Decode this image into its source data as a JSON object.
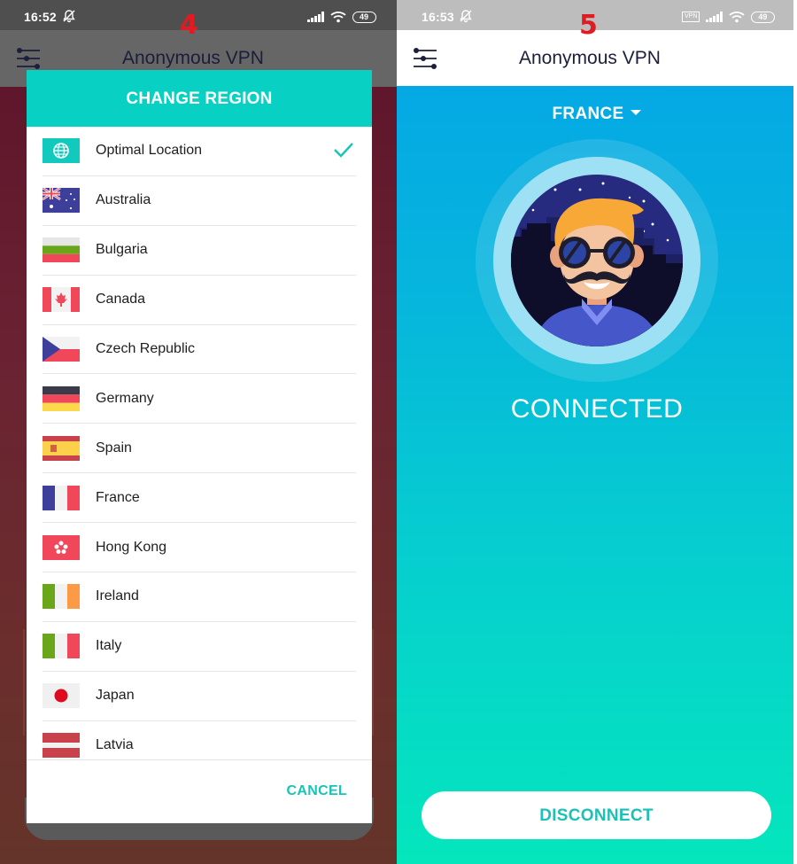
{
  "screen_left": {
    "step_number": "4",
    "status_bar": {
      "time": "16:52",
      "battery": "49"
    },
    "app_title": "Anonymous VPN",
    "dialog": {
      "title": "CHANGE REGION",
      "selected_index": 0,
      "regions": [
        {
          "label": "Optimal Location",
          "flag": "globe",
          "selected": true
        },
        {
          "label": "Australia",
          "flag": "au"
        },
        {
          "label": "Bulgaria",
          "flag": "bg"
        },
        {
          "label": "Canada",
          "flag": "ca"
        },
        {
          "label": "Czech Republic",
          "flag": "cz"
        },
        {
          "label": "Germany",
          "flag": "de"
        },
        {
          "label": "Spain",
          "flag": "es"
        },
        {
          "label": "France",
          "flag": "fr"
        },
        {
          "label": "Hong Kong",
          "flag": "hk"
        },
        {
          "label": "Ireland",
          "flag": "ie"
        },
        {
          "label": "Italy",
          "flag": "it"
        },
        {
          "label": "Japan",
          "flag": "jp"
        },
        {
          "label": "Latvia",
          "flag": "lv"
        }
      ],
      "cancel_label": "CANCEL"
    }
  },
  "screen_right": {
    "step_number": "5",
    "status_bar": {
      "time": "16:53",
      "vpn_badge": "VPN",
      "battery": "49"
    },
    "app_title": "Anonymous VPN",
    "selected_region": "FRANCE",
    "connection_status": "CONNECTED",
    "disconnect_label": "DISCONNECT"
  },
  "colors": {
    "accent_teal": "#08d1c3",
    "button_text_teal": "#19c3b8",
    "title_navy": "#1c1e3a",
    "step_red": "#e11b22"
  }
}
